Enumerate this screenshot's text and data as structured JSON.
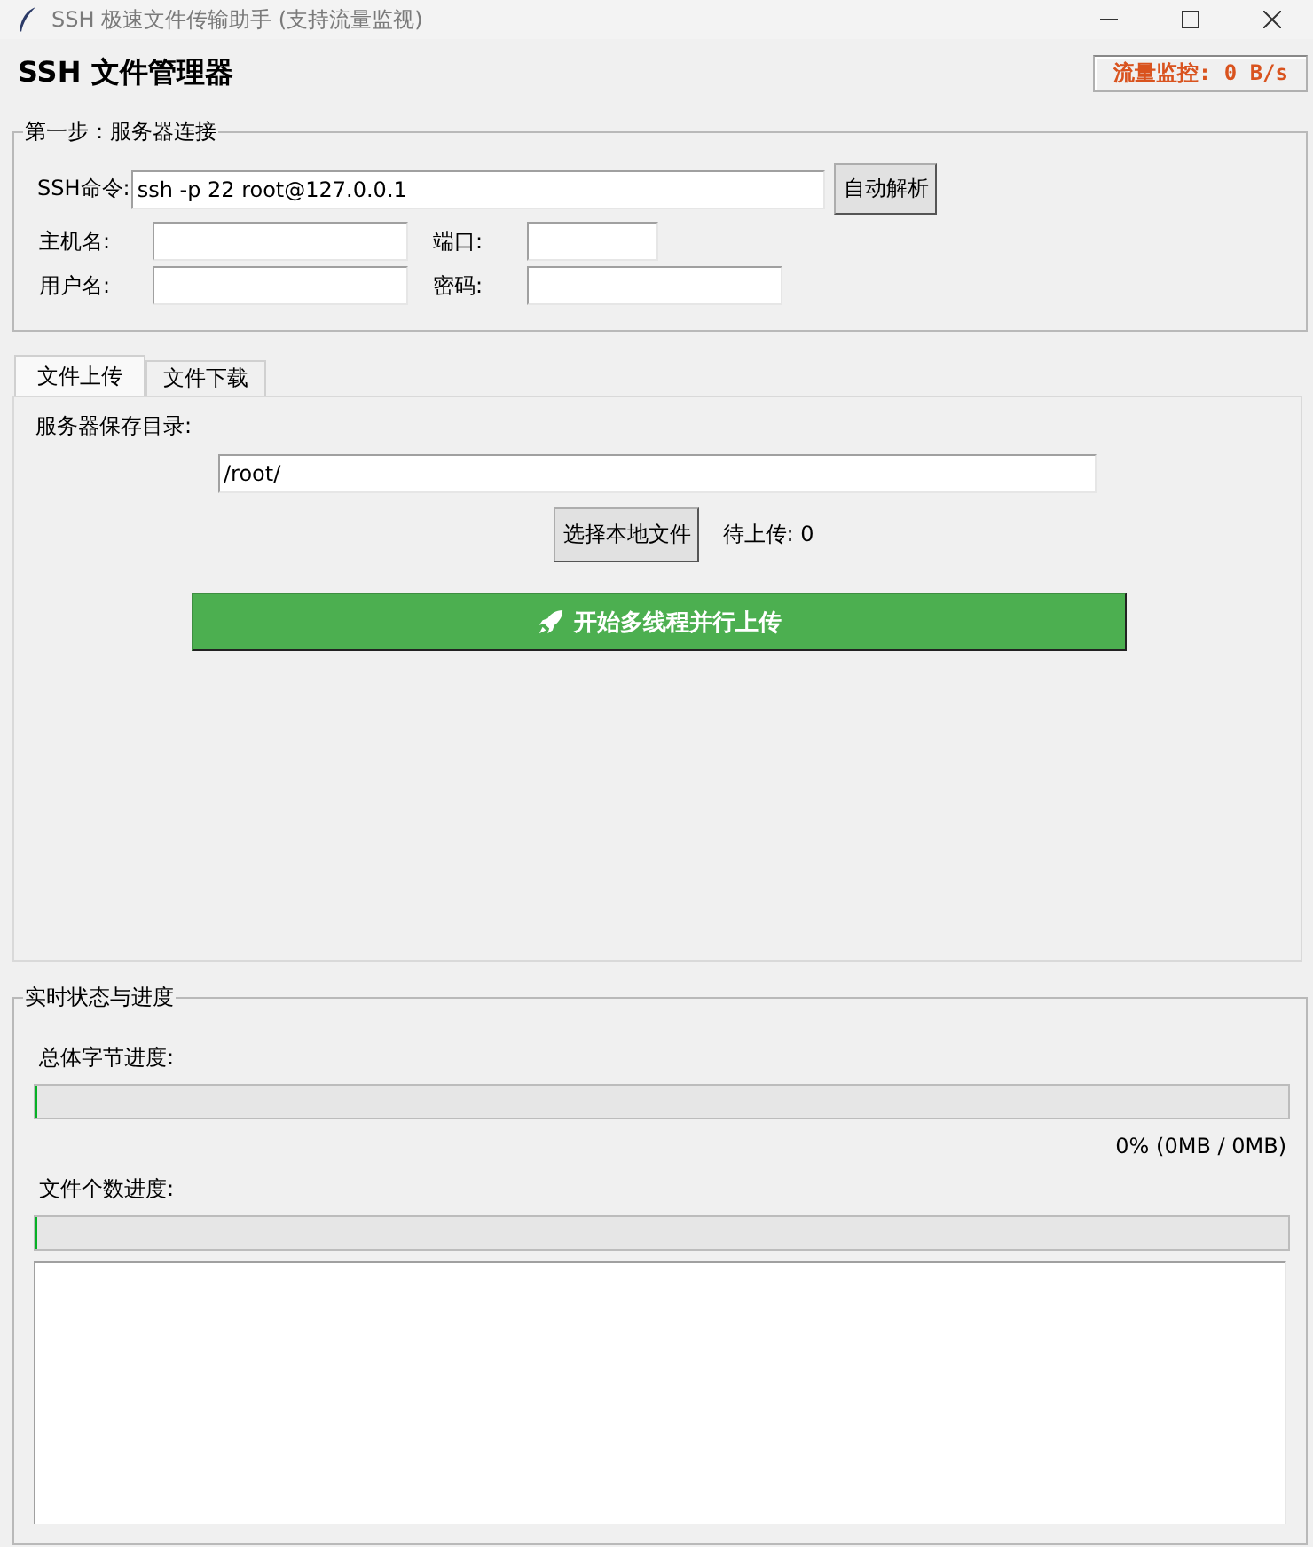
{
  "window": {
    "title": "SSH 极速文件传输助手 (支持流量监视)"
  },
  "header": {
    "title": "SSH 文件管理器",
    "traffic": "流量监控: 0 B/s"
  },
  "connection": {
    "title": "第一步：服务器连接",
    "ssh_label": "SSH命令:",
    "ssh_value": "ssh -p 22 root@127.0.0.1",
    "parse_button": "自动解析",
    "fields": [
      {
        "label": "主机名:"
      },
      {
        "label": "端口:"
      },
      {
        "label": "用户名:"
      },
      {
        "label": "密码:"
      }
    ]
  },
  "tabs": [
    {
      "label": "文件上传",
      "selected": true
    },
    {
      "label": "文件下载",
      "selected": false
    }
  ],
  "upload": {
    "dir_label": "服务器保存目录:",
    "dir_value": "/root/",
    "choose_button": "选择本地文件",
    "pending": "待上传: 0",
    "start_button": "开始多线程并行上传"
  },
  "progress": {
    "title": "实时状态与进度",
    "bars": [
      {
        "label": "总体字节进度:",
        "level": 0,
        "reading": "0% (0MB / 0MB)"
      },
      {
        "label": "文件个数进度:",
        "level": 0
      }
    ]
  }
}
